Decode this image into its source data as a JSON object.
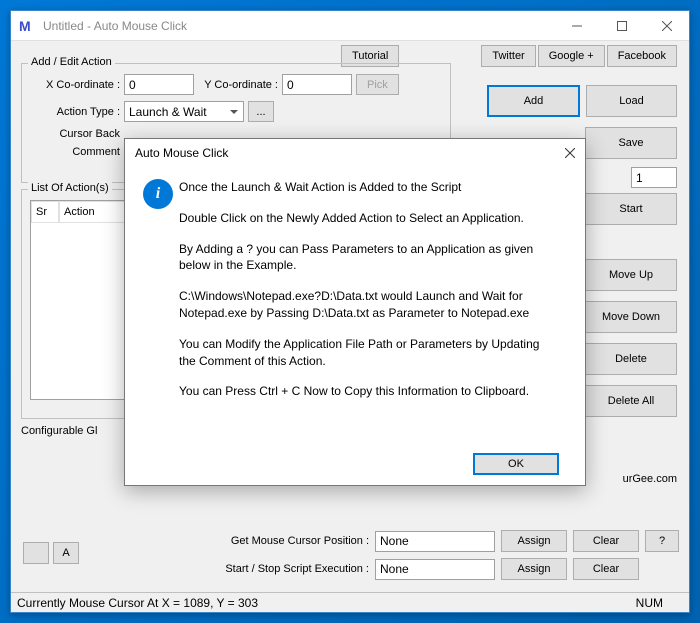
{
  "window": {
    "title": "Untitled - Auto Mouse Click",
    "app_icon": "M"
  },
  "top_links": {
    "tutorial": "Tutorial",
    "twitter": "Twitter",
    "google": "Google +",
    "facebook": "Facebook"
  },
  "groupbox": {
    "title": "Add / Edit Action",
    "x_label": "X Co-ordinate :",
    "x_value": "0",
    "y_label": "Y Co-ordinate :",
    "y_value": "0",
    "pick": "Pick",
    "action_type_label": "Action Type :",
    "action_type_value": "Launch & Wait",
    "ellipsis": "...",
    "cursor_back_label": "Cursor Back",
    "comment_label": "Comment"
  },
  "right_buttons": {
    "add": "Add",
    "load": "Load",
    "save": "Save",
    "start": "Start",
    "move_up": "Move Up",
    "move_down": "Move Down",
    "delete": "Delete",
    "delete_all": "Delete All"
  },
  "repeat": {
    "value": "1"
  },
  "list": {
    "title": "List Of Action(s)",
    "col_sr": "Sr",
    "col_action": "Action"
  },
  "config_global": "Configurable Gl",
  "murgee": "urGee.com",
  "bottom": {
    "get_cursor_label": "Get Mouse Cursor Position :",
    "get_cursor_value": "None",
    "start_stop_label": "Start / Stop Script Execution :",
    "start_stop_value": "None",
    "assign": "Assign",
    "clear": "Clear",
    "help": "?"
  },
  "corner": {
    "blank": "",
    "a": "A"
  },
  "status": {
    "text": "Currently Mouse Cursor At X = 1089, Y = 303",
    "num": "NUM"
  },
  "dialog": {
    "title": "Auto Mouse Click",
    "p1": "Once the Launch & Wait Action is Added to the Script",
    "p2": "Double Click on the Newly Added Action to Select an Application.",
    "p3": "By Adding a ? you can Pass Parameters to an Application as given below in the Example.",
    "p4": "C:\\Windows\\Notepad.exe?D:\\Data.txt would Launch and Wait for Notepad.exe by Passing D:\\Data.txt as Parameter to Notepad.exe",
    "p5": "You can Modify the Application File Path or Parameters by Updating the Comment of this Action.",
    "p6": "You can Press Ctrl + C Now to Copy this Information to Clipboard.",
    "ok": "OK"
  }
}
